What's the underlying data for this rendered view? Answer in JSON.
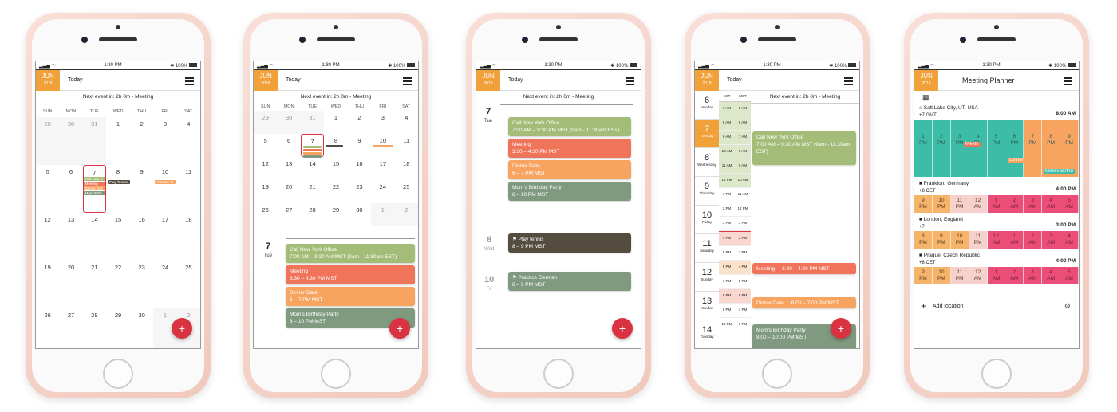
{
  "status": {
    "time": "1:30 PM",
    "battery": "100%"
  },
  "header": {
    "month": "JUN",
    "year": "2018",
    "today": "Today"
  },
  "next_event": "Next event in: 2h 0m - Meeting",
  "fab": "+",
  "weekdays": [
    "SUN",
    "MON",
    "TUE",
    "WED",
    "THU",
    "FRI",
    "SAT"
  ],
  "phone1": {
    "weeks": [
      [
        "29",
        "30",
        "31",
        "1",
        "2",
        "3",
        "4"
      ],
      [
        "5",
        "6",
        "7",
        "8",
        "9",
        "10",
        "11"
      ],
      [
        "12",
        "13",
        "14",
        "15",
        "16",
        "17",
        "18"
      ],
      [
        "19",
        "20",
        "21",
        "22",
        "23",
        "24",
        "25"
      ],
      [
        "26",
        "27",
        "28",
        "29",
        "30",
        "1",
        "2"
      ]
    ],
    "pills": [
      "Call New Y",
      "Meeting",
      "Dinner Dat",
      "Mom Birth"
    ],
    "play": "Play Tennis",
    "practice": "Practice G"
  },
  "phone2": {
    "weeks": [
      [
        "29",
        "30",
        "31",
        "1",
        "2",
        "3",
        "4"
      ],
      [
        "5",
        "6",
        "7",
        "8",
        "9",
        "10",
        "11"
      ],
      [
        "12",
        "13",
        "14",
        "15",
        "16",
        "17",
        "18"
      ],
      [
        "19",
        "20",
        "21",
        "22",
        "23",
        "24",
        "25"
      ],
      [
        "26",
        "27",
        "28",
        "29",
        "30",
        "1",
        "2"
      ]
    ],
    "day": "7",
    "dayname": "Tue"
  },
  "events": {
    "call": {
      "title": "Call New York Office",
      "time": "7:00 AM – 9:30 AM MST (9am - 11:30am EST)"
    },
    "meeting": {
      "title": "Meeting",
      "time": "3:30 – 4:30 PM MST"
    },
    "dinner": {
      "title": "Dinner Date",
      "time": "6 – 7 PM MST"
    },
    "mom": {
      "title": "Mom's Birthday Party",
      "time": "8 – 10 PM MST"
    },
    "tennis": {
      "title": "Play tennis",
      "time": "8 – 9 PM MST"
    },
    "german": {
      "title": "Practice German",
      "time": "8 – 9 PM MST"
    }
  },
  "phone3": {
    "d7": "7",
    "d7n": "Tue",
    "d8": "8",
    "d8n": "Wed",
    "d10": "10",
    "d10n": "Fri"
  },
  "phone4": {
    "tz": [
      "EST",
      "MST"
    ],
    "days": [
      {
        "n": "6",
        "d": "Monday"
      },
      {
        "n": "7",
        "d": "Tuesday"
      },
      {
        "n": "8",
        "d": "Wednesday"
      },
      {
        "n": "9",
        "d": "Thursday"
      },
      {
        "n": "10",
        "d": "Friday"
      },
      {
        "n": "11",
        "d": "Saturday"
      },
      {
        "n": "12",
        "d": "Sunday"
      },
      {
        "n": "13",
        "d": "Monday"
      },
      {
        "n": "14",
        "d": "Tuesday"
      }
    ],
    "est": [
      "7 AM",
      "8 AM",
      "9 AM",
      "10 AM",
      "11 AM",
      "12 PM",
      "1 PM",
      "2 PM",
      "3 PM",
      "4 PM",
      "5 PM",
      "6 PM",
      "7 PM",
      "8 PM",
      "9 PM",
      "10 PM"
    ],
    "mst": [
      "5 AM",
      "6 AM",
      "7 AM",
      "8 AM",
      "9 AM",
      "10 AM",
      "11 AM",
      "12 PM",
      "1 PM",
      "2 PM",
      "3 PM",
      "4 PM",
      "5 PM",
      "6 PM",
      "7 PM",
      "8 PM"
    ],
    "call_title": "Call New York Office",
    "call_time": "7:00 AM – 9:30 AM MST (9am - 11:30am EST)",
    "meeting": "Meeting     3:30 – 4:30 PM MST",
    "dinner": "Dinner Date     6:00 – 7:00 PM MST",
    "mom_title": "Mom's Birthday Party",
    "mom_time": "8:00 – 10:00 PM MST"
  },
  "phone5": {
    "title": "Meeting Planner",
    "add": "Add location",
    "locations": [
      {
        "name": "Salt Lake City, UT, USA",
        "offset": "+7 GMT",
        "time": "8:00 AM",
        "cells": [
          "1\nPM",
          "2\nPM",
          "3\nPM",
          "4\nPM",
          "5\nPM",
          "6\nPM",
          "7\nPM",
          "8\nPM",
          "9\nPM"
        ],
        "tag1": "Meetir",
        "tag2": "Dinner",
        "tag3": "Mom's Birthd"
      },
      {
        "name": "Frankfurt, Germany",
        "offset": "+8 CET",
        "time": "4:00 PM",
        "cells": [
          "9\nPM",
          "10\nPM",
          "11\nPM",
          "12\nAM",
          "1\nAM",
          "2\nAM",
          "3\nAM",
          "4\nAM",
          "5\nAM"
        ]
      },
      {
        "name": "London, England",
        "offset": "+7",
        "time": "3:00 PM",
        "cells": [
          "8\nPM",
          "9\nPM",
          "10\nPM",
          "11\nPM",
          "12\nAM",
          "1\nAM",
          "2\nAM",
          "3\nAM",
          "4\nAM"
        ]
      },
      {
        "name": "Prague, Czech Republic",
        "offset": "+8 CET",
        "time": "4:00 PM",
        "cells": [
          "9\nPM",
          "10\nPM",
          "11\nPM",
          "12\nAM",
          "1\nAM",
          "2\nAM",
          "3\nAM",
          "4\nAM",
          "5\nAM"
        ]
      }
    ]
  }
}
